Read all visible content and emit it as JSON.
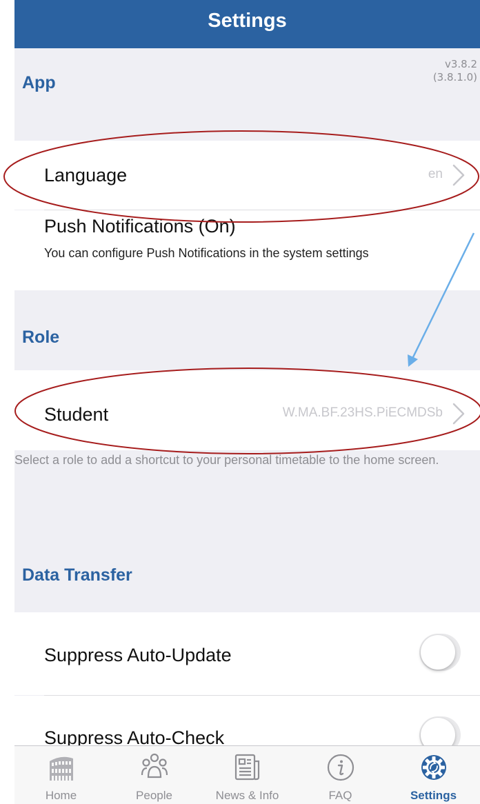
{
  "header": {
    "title": "Settings"
  },
  "app_section": {
    "title": "App",
    "version": "v3.8.2",
    "build": "(3.8.1.0)"
  },
  "language": {
    "label": "Language",
    "value": "en"
  },
  "push": {
    "label": "Push Notifications (On)",
    "description": "You can configure Push Notifications in the system settings"
  },
  "role_section": {
    "title": "Role"
  },
  "role": {
    "label": "Student",
    "value": "W.MA.BF.23HS.PiECMDSb",
    "footer": "Select a role to add a shortcut to your personal timetable to the home screen."
  },
  "data_section": {
    "title": "Data Transfer"
  },
  "toggles": [
    {
      "label": "Suppress Auto-Update",
      "on": false
    },
    {
      "label": "Suppress Auto-Check",
      "on": false
    }
  ],
  "tabs": [
    {
      "label": "Home",
      "icon": "colosseum-icon",
      "active": false
    },
    {
      "label": "People",
      "icon": "people-icon",
      "active": false
    },
    {
      "label": "News & Info",
      "icon": "newspaper-icon",
      "active": false
    },
    {
      "label": "FAQ",
      "icon": "info-circle-icon",
      "active": false
    },
    {
      "label": "Settings",
      "icon": "gear-icon",
      "active": true
    }
  ],
  "colors": {
    "nav_bar": "#2b62a1",
    "section_title": "#2b62a1",
    "annotation_ellipse": "#a61c1c",
    "annotation_arrow": "#6aaee8"
  }
}
